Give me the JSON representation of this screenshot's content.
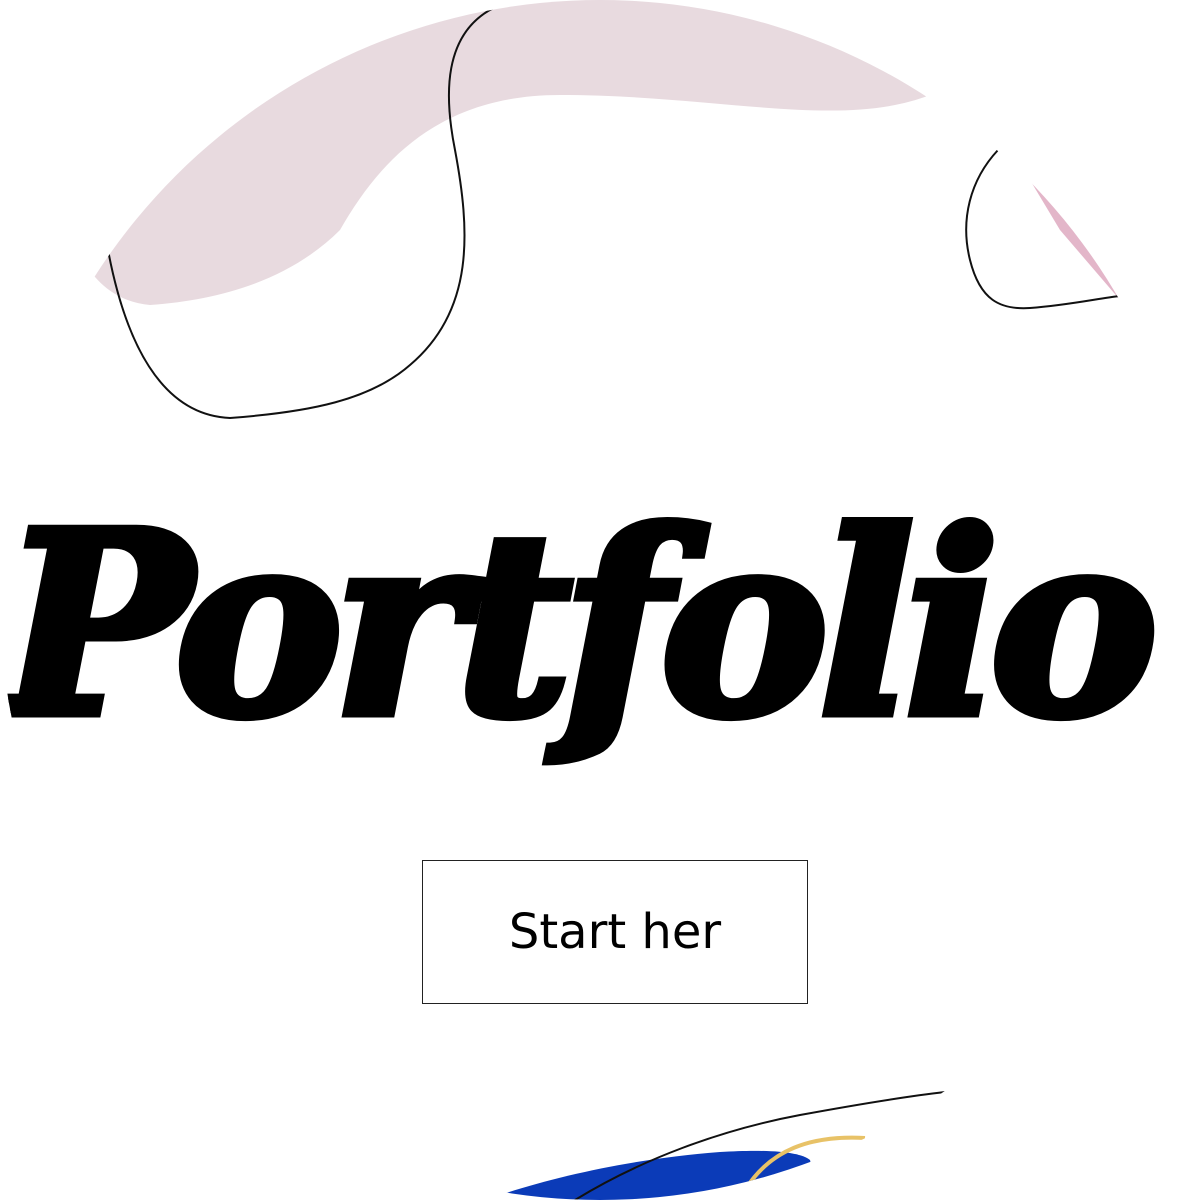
{
  "hero": {
    "title": "Portfolio",
    "button_label": "Start her"
  },
  "colors": {
    "background": "#ffffff",
    "text": "#000000",
    "blob_pink": "#e8dadf",
    "accent_pink": "#e3b6c9",
    "accent_blue": "#0b3bb8",
    "accent_gold": "#e8c267",
    "line": "#111111"
  },
  "decorations": [
    "pink-blob-shape",
    "outline-curve-shape",
    "blue-wave-shape",
    "gold-arc-shape"
  ]
}
